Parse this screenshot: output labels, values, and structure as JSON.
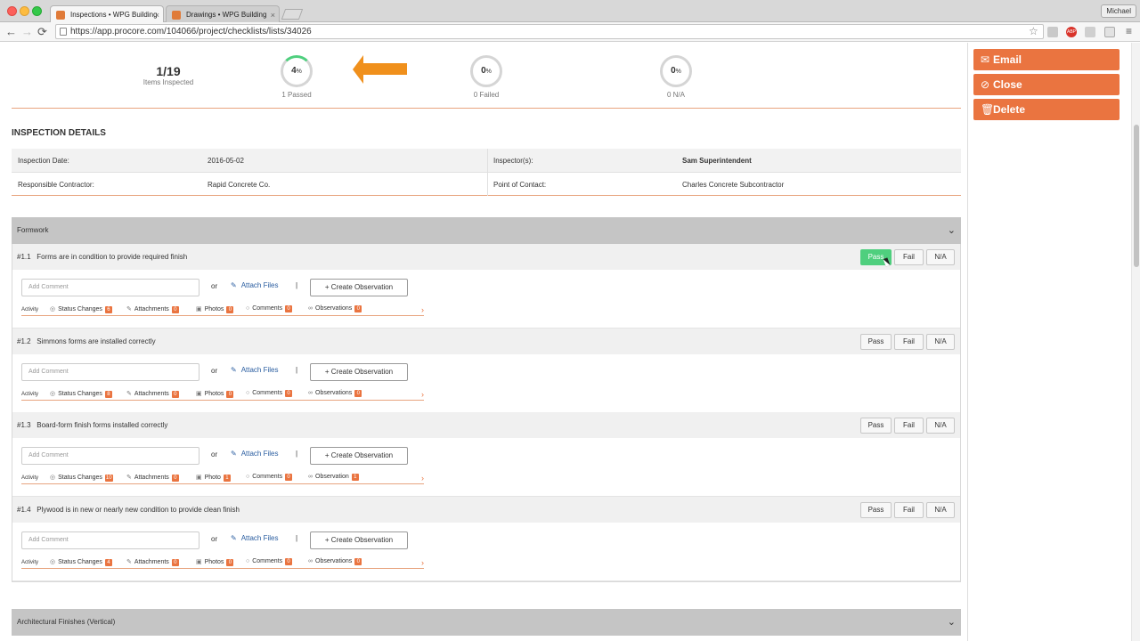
{
  "browser": {
    "tabs": [
      {
        "label": "Inspections • WPG Building",
        "close": "×"
      },
      {
        "label": "Drawings • WPG Building",
        "close": "×"
      }
    ],
    "user": "Michael",
    "url": "https://app.procore.com/104066/project/checklists/lists/34026",
    "back": "←",
    "forward": "→",
    "reload": "⟳",
    "star": "☆",
    "menu": "≡",
    "adblock_label": "ABP"
  },
  "summary": {
    "inspected_count": "1/19",
    "inspected_label": "Items Inspected",
    "passed": {
      "value": "4",
      "unit": "%",
      "label": "1 Passed",
      "fraction": 0.04
    },
    "failed": {
      "value": "0",
      "unit": "%",
      "label": "0 Failed"
    },
    "na": {
      "value": "0",
      "unit": "%",
      "label": "0 N/A"
    }
  },
  "actions": {
    "email": "Email",
    "close": "Close",
    "delete": "Delete"
  },
  "details": {
    "title": "INSPECTION DETAILS",
    "inspection_date_label": "Inspection Date:",
    "inspection_date": "2016-05-02",
    "inspectors_label": "Inspector(s):",
    "inspectors": "Sam Superintendent",
    "responsible_label": "Responsible Contractor:",
    "responsible": "Rapid Concrete Co.",
    "poc_label": "Point of Contact:",
    "poc": "Charles Concrete Subcontractor"
  },
  "sections": [
    {
      "title": "Formwork",
      "chevron": "⌄"
    },
    {
      "title": "Architectural Finishes (Vertical)",
      "chevron": "⌄"
    }
  ],
  "buttons": {
    "pass": "Pass",
    "fail": "Fail",
    "na": "N/A"
  },
  "common": {
    "comment_placeholder": "Add Comment",
    "or": "or",
    "attach": "Attach Files",
    "pipe": "|",
    "create": "+ Create Observation",
    "activity": "Activity",
    "arrow": "›"
  },
  "items": [
    {
      "number": "#1.1",
      "text": "Forms are in condition to provide required finish",
      "status": "pass",
      "status_changes_label": "Status Changes",
      "status_changes": "6",
      "attachments_label": "Attachments",
      "attachments": "0",
      "photos_label": "Photos",
      "photos": "0",
      "comments_label": "Comments",
      "comments": "0",
      "observations_label": "Observations",
      "observations": "0"
    },
    {
      "number": "#1.2",
      "text": "Simmons forms are installed correctly",
      "status": "",
      "status_changes_label": "Status Changes",
      "status_changes": "8",
      "attachments_label": "Attachments",
      "attachments": "0",
      "photos_label": "Photos",
      "photos": "0",
      "comments_label": "Comments",
      "comments": "0",
      "observations_label": "Observations",
      "observations": "0"
    },
    {
      "number": "#1.3",
      "text": "Board-form finish forms installed correctly",
      "status": "",
      "status_changes_label": "Status Changes",
      "status_changes": "10",
      "attachments_label": "Attachments",
      "attachments": "0",
      "photos_label": "Photo",
      "photos": "1",
      "comments_label": "Comments",
      "comments": "0",
      "observations_label": "Observation",
      "observations": "1"
    },
    {
      "number": "#1.4",
      "text": "Plywood is in new or nearly new condition to provide clean finish",
      "status": "",
      "status_changes_label": "Status Changes",
      "status_changes": "4",
      "attachments_label": "Attachments",
      "attachments": "0",
      "photos_label": "Photos",
      "photos": "0",
      "comments_label": "Comments",
      "comments": "0",
      "observations_label": "Observations",
      "observations": "0"
    }
  ],
  "colors": {
    "accent": "#ea7440",
    "pass_green": "#4fcf7e",
    "arrow_orange": "#f0901c"
  }
}
